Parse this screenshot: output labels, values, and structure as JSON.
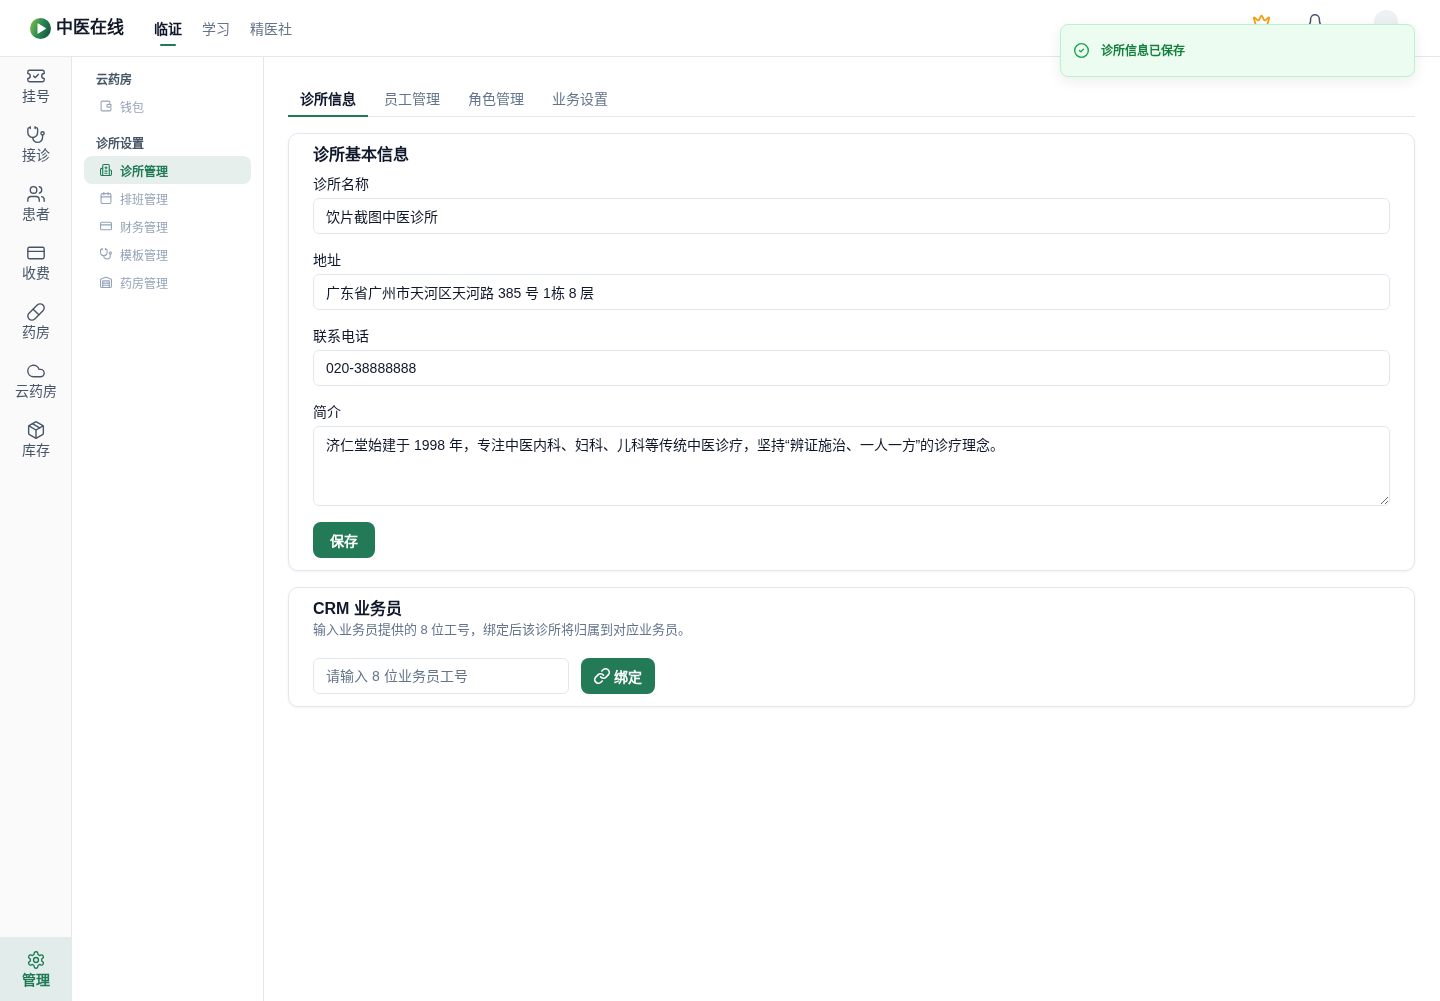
{
  "header": {
    "logo_text": "中医在线",
    "nav": [
      {
        "label": "临证",
        "selected": true
      },
      {
        "label": "学习",
        "selected": false
      },
      {
        "label": "精医社",
        "selected": false
      }
    ]
  },
  "toast": {
    "message": "诊所信息已保存"
  },
  "rail": {
    "items": [
      {
        "label": "挂号",
        "selected": false
      },
      {
        "label": "接诊",
        "selected": false
      },
      {
        "label": "患者",
        "selected": false
      },
      {
        "label": "收费",
        "selected": false
      },
      {
        "label": "药房",
        "selected": false
      },
      {
        "label": "云药房",
        "selected": false
      },
      {
        "label": "库存",
        "selected": false
      }
    ],
    "bottom_items": [
      {
        "label": "管理",
        "selected": true
      }
    ]
  },
  "sidebar": {
    "groups": [
      {
        "title": "云药房",
        "items": [
          {
            "label": "钱包",
            "selected": false
          }
        ]
      },
      {
        "title": "诊所设置",
        "items": [
          {
            "label": "诊所管理",
            "selected": true
          },
          {
            "label": "排班管理",
            "selected": false
          },
          {
            "label": "财务管理",
            "selected": false
          },
          {
            "label": "模板管理",
            "selected": false
          },
          {
            "label": "药房管理",
            "selected": false
          }
        ]
      }
    ]
  },
  "tabs": [
    {
      "label": "诊所信息",
      "selected": true
    },
    {
      "label": "员工管理",
      "selected": false
    },
    {
      "label": "角色管理",
      "selected": false
    },
    {
      "label": "业务设置",
      "selected": false
    }
  ],
  "clinic_info": {
    "title": "诊所基本信息",
    "fields": [
      {
        "kind": "input",
        "label": "诊所名称",
        "value": "饮片截图中医诊所"
      },
      {
        "kind": "input",
        "label": "地址",
        "value": "广东省广州市天河区天河路 385 号 1栋 8 层"
      },
      {
        "kind": "input",
        "label": "联系电话",
        "value": "020-38888888"
      },
      {
        "kind": "textarea",
        "label": "简介",
        "value": "济仁堂始建于 1998 年，专注中医内科、妇科、儿科等传统中医诊疗，坚持“辨证施治、一人一方”的诊疗理念。"
      }
    ],
    "save_button": "保存"
  },
  "crm": {
    "title": "CRM 业务员",
    "description": "输入业务员提供的 8 位工号，绑定后该诊所将归属到对应业务员。",
    "input": {
      "placeholder": "请输入 8 位业务员工号"
    },
    "bind_button": "绑定"
  }
}
